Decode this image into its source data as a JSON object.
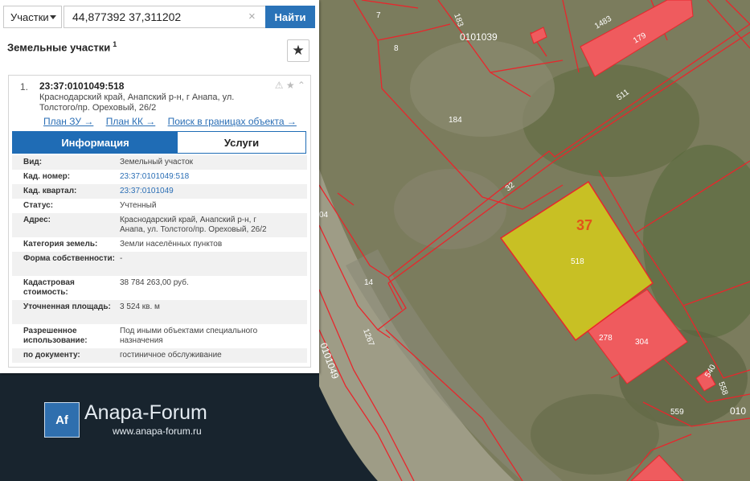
{
  "search": {
    "type_label": "Участки",
    "query": "44,877392 37,311202",
    "clear_symbol": "×",
    "submit_label": "Найти"
  },
  "panel": {
    "title": "Земельные участки",
    "title_count": "1",
    "star_symbol": "★"
  },
  "result": {
    "index": "1.",
    "cad_number": "23:37:0101049:518",
    "address": "Краснодарский край, Анапский р-н, г Анапа, ул. Толстого/пр. Ореховый, 26/2",
    "icons": "⚠ ★ ⌃",
    "links": {
      "plan_zu": "План ЗУ →",
      "plan_kk": "План КК →",
      "search_bounds": "Поиск в границах объекта →"
    },
    "tabs": {
      "info": "Информация",
      "services": "Услуги"
    },
    "attributes": [
      {
        "key": "Вид:",
        "value": "Земельный участок"
      },
      {
        "key": "Кад. номер:",
        "value": "23:37:0101049:518"
      },
      {
        "key": "Кад. квартал:",
        "value": "23:37:0101049"
      },
      {
        "key": "Статус:",
        "value": "Учтенный"
      },
      {
        "key": "Адрес:",
        "value": "Краснодарский край, Анапский р-н, г Анапа, ул. Толстого/пр. Ореховый, 26/2"
      },
      {
        "key": "Категория земель:",
        "value": "Земли населённых пунктов"
      },
      {
        "key": "Форма собственности:",
        "value": "-"
      },
      {
        "key": "Кадастровая стоимость:",
        "value": "38 784 263,00 руб."
      },
      {
        "key": "Уточненная площадь:",
        "value": "3 524 кв. м"
      },
      {
        "key": "Разрешенное использование:",
        "value": "Под иными объектами специального назначения"
      },
      {
        "key": "по документу:",
        "value": "гостиничное обслуживание"
      }
    ]
  },
  "map": {
    "labels": {
      "l7": "7",
      "l183": "183",
      "l1483": "1483",
      "l179": "179",
      "q0101039": "0101039",
      "l8": "8",
      "l511": "511",
      "l184": "184",
      "l32": "32",
      "l37": "37",
      "l518": "518",
      "l14": "14",
      "l278": "278",
      "l304": "304",
      "l1267": "1267",
      "l540": "540",
      "l558": "558",
      "l559": "559",
      "q010": "010",
      "l04": "04",
      "q0101049": "0101049"
    },
    "colors": {
      "selected_fill": "#d6cc1a",
      "building_fill": "#ef5b5e",
      "boundary": "#e8262c"
    }
  },
  "watermark": {
    "logo": "Af",
    "name": "Anapa-Forum",
    "url": "www.anapa-forum.ru"
  }
}
